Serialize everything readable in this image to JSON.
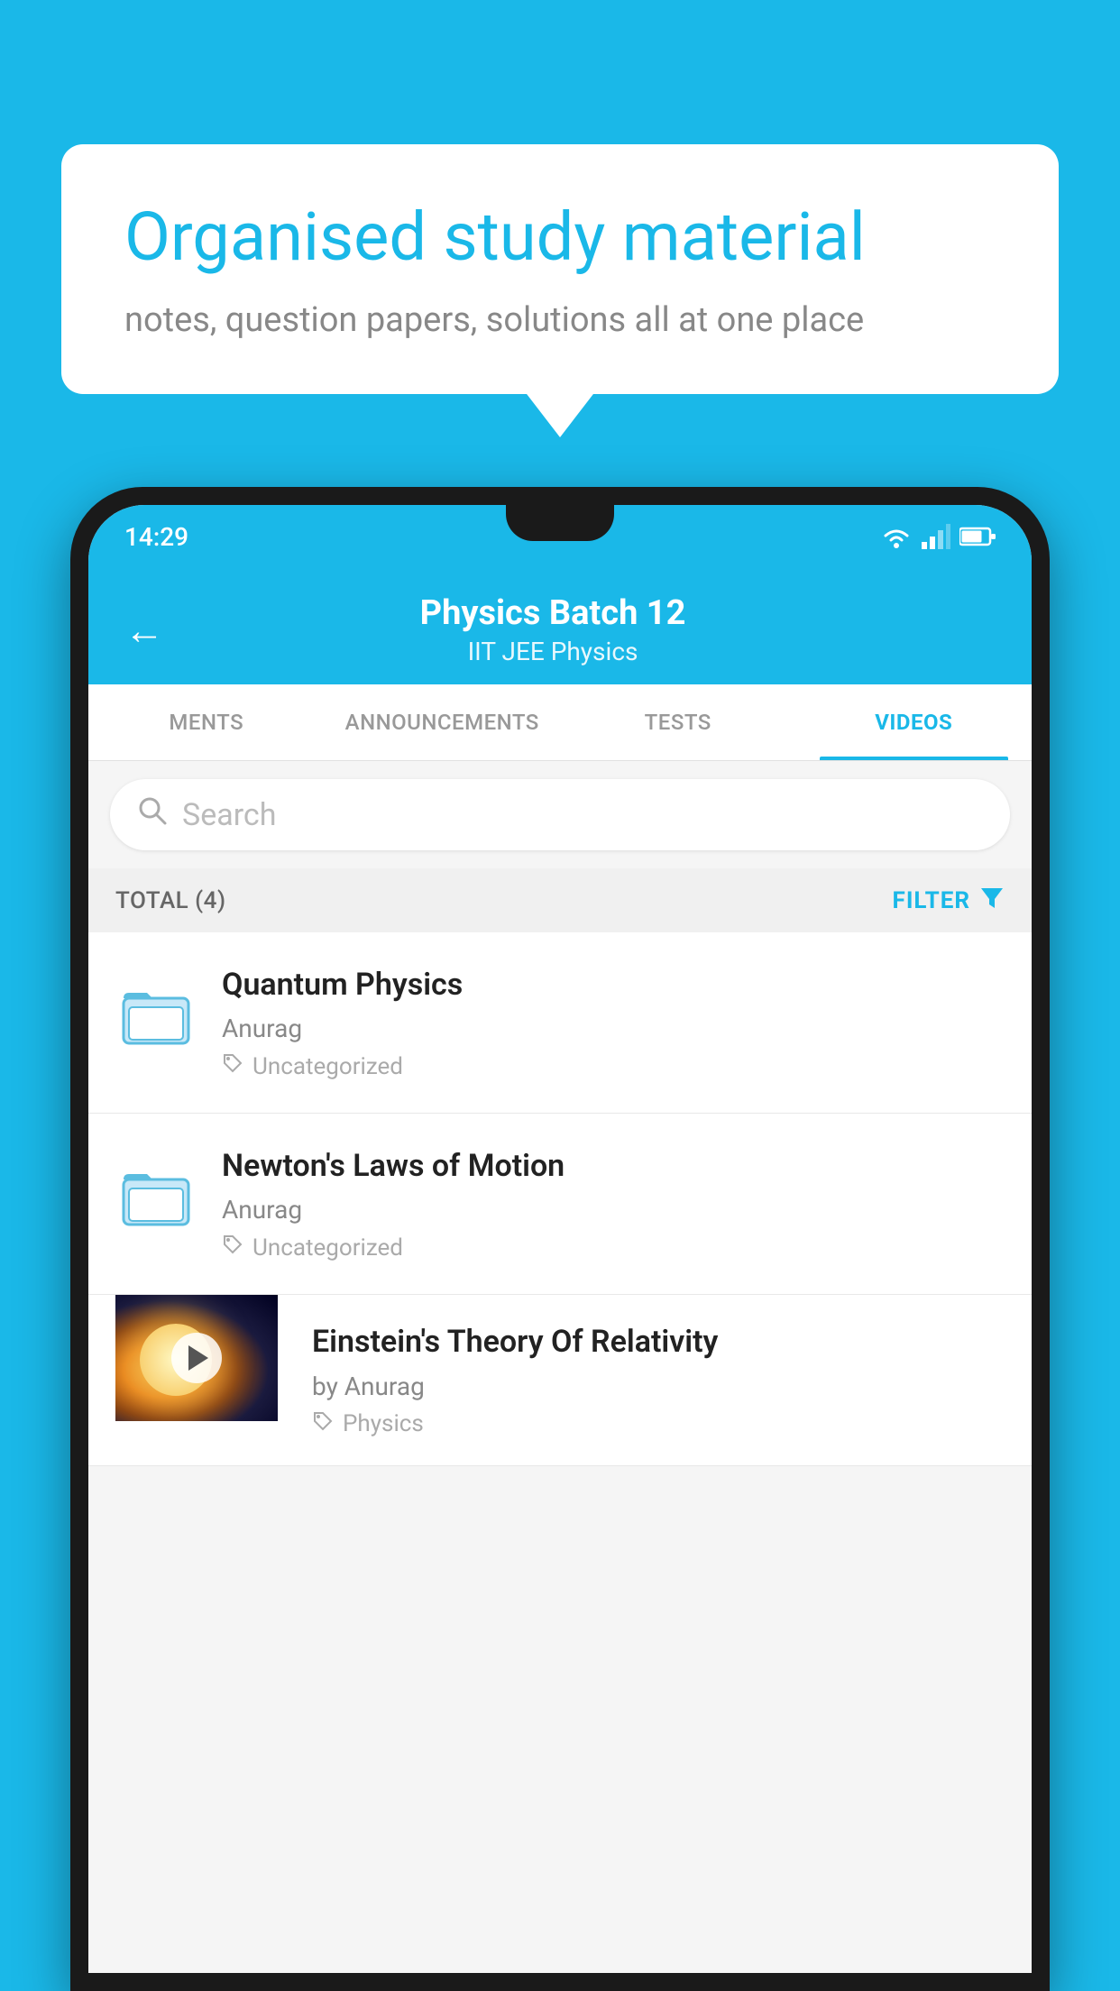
{
  "background_color": "#1ab8e8",
  "bubble": {
    "title": "Organised study material",
    "subtitle": "notes, question papers, solutions all at one place"
  },
  "status_bar": {
    "time": "14:29"
  },
  "header": {
    "title": "Physics Batch 12",
    "subtitle": "IIT JEE   Physics",
    "back_label": "←"
  },
  "tabs": [
    {
      "label": "MENTS",
      "active": false
    },
    {
      "label": "ANNOUNCEMENTS",
      "active": false
    },
    {
      "label": "TESTS",
      "active": false
    },
    {
      "label": "VIDEOS",
      "active": true
    }
  ],
  "search": {
    "placeholder": "Search"
  },
  "filter": {
    "total_label": "TOTAL (4)",
    "filter_label": "FILTER"
  },
  "videos": [
    {
      "id": 1,
      "title": "Quantum Physics",
      "author": "Anurag",
      "tag": "Uncategorized",
      "type": "folder",
      "has_thumbnail": false
    },
    {
      "id": 2,
      "title": "Newton's Laws of Motion",
      "author": "Anurag",
      "tag": "Uncategorized",
      "type": "folder",
      "has_thumbnail": false
    },
    {
      "id": 3,
      "title": "Einstein's Theory Of Relativity",
      "author": "by Anurag",
      "tag": "Physics",
      "type": "video",
      "has_thumbnail": true
    }
  ]
}
